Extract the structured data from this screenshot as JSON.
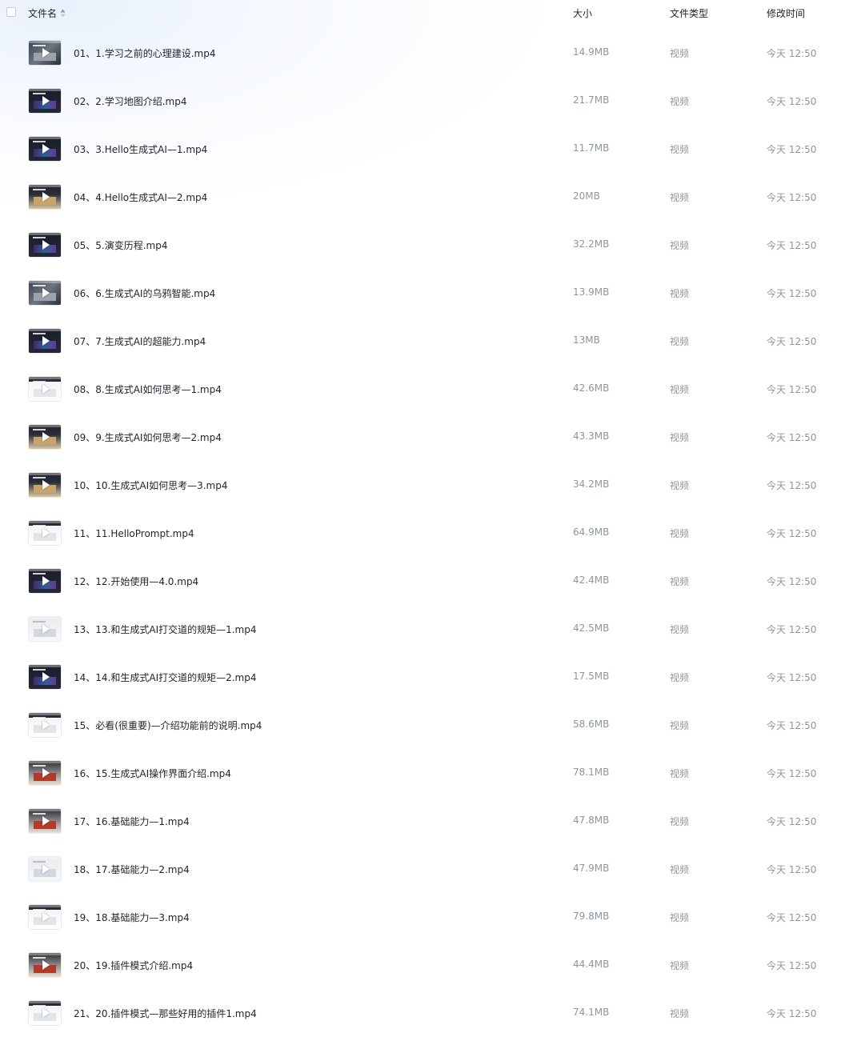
{
  "header": {
    "name": "文件名",
    "size": "大小",
    "type": "文件类型",
    "time": "修改时间"
  },
  "files": [
    {
      "name": "01、1.学习之前的心理建设.mp4",
      "size": "14.9MB",
      "type": "视频",
      "time": "今天 12:50",
      "thumb": "th-photo"
    },
    {
      "name": "02、2.学习地图介绍.mp4",
      "size": "21.7MB",
      "type": "视频",
      "time": "今天 12:50",
      "thumb": "th-dark"
    },
    {
      "name": "03、3.Hello生成式AI—1.mp4",
      "size": "11.7MB",
      "type": "视频",
      "time": "今天 12:50",
      "thumb": "th-dark"
    },
    {
      "name": "04、4.Hello生成式AI—2.mp4",
      "size": "20MB",
      "type": "视频",
      "time": "今天 12:50",
      "thumb": "th-mixed"
    },
    {
      "name": "05、5.演变历程.mp4",
      "size": "32.2MB",
      "type": "视频",
      "time": "今天 12:50",
      "thumb": "th-dark"
    },
    {
      "name": "06、6.生成式AI的乌鸦智能.mp4",
      "size": "13.9MB",
      "type": "视频",
      "time": "今天 12:50",
      "thumb": "th-photo"
    },
    {
      "name": "07、7.生成式AI的超能力.mp4",
      "size": "13MB",
      "type": "视频",
      "time": "今天 12:50",
      "thumb": "th-dark"
    },
    {
      "name": "08、8.生成式AI如何思考—1.mp4",
      "size": "42.6MB",
      "type": "视频",
      "time": "今天 12:50",
      "thumb": "th-white"
    },
    {
      "name": "09、9.生成式AI如何思考—2.mp4",
      "size": "43.3MB",
      "type": "视频",
      "time": "今天 12:50",
      "thumb": "th-mixed"
    },
    {
      "name": "10、10.生成式AI如何思考—3.mp4",
      "size": "34.2MB",
      "type": "视频",
      "time": "今天 12:50",
      "thumb": "th-mixed"
    },
    {
      "name": "11、11.HelloPrompt.mp4",
      "size": "64.9MB",
      "type": "视频",
      "time": "今天 12:50",
      "thumb": "th-white"
    },
    {
      "name": "12、12.开始使用—4.0.mp4",
      "size": "42.4MB",
      "type": "视频",
      "time": "今天 12:50",
      "thumb": "th-dark"
    },
    {
      "name": "13、13.和生成式AI打交道的规矩—1.mp4",
      "size": "42.5MB",
      "type": "视频",
      "time": "今天 12:50",
      "thumb": "th-light"
    },
    {
      "name": "14、14.和生成式AI打交道的规矩—2.mp4",
      "size": "17.5MB",
      "type": "视频",
      "time": "今天 12:50",
      "thumb": "th-dark"
    },
    {
      "name": "15、必看(很重要)—介绍功能前的说明.mp4",
      "size": "58.6MB",
      "type": "视频",
      "time": "今天 12:50",
      "thumb": "th-white"
    },
    {
      "name": "16、15.生成式AI操作界面介绍.mp4",
      "size": "78.1MB",
      "type": "视频",
      "time": "今天 12:50",
      "thumb": "th-warm"
    },
    {
      "name": "17、16.基础能力—1.mp4",
      "size": "47.8MB",
      "type": "视频",
      "time": "今天 12:50",
      "thumb": "th-warm"
    },
    {
      "name": "18、17.基础能力—2.mp4",
      "size": "47.9MB",
      "type": "视频",
      "time": "今天 12:50",
      "thumb": "th-light"
    },
    {
      "name": "19、18.基础能力—3.mp4",
      "size": "79.8MB",
      "type": "视频",
      "time": "今天 12:50",
      "thumb": "th-white"
    },
    {
      "name": "20、19.插件模式介绍.mp4",
      "size": "44.4MB",
      "type": "视频",
      "time": "今天 12:50",
      "thumb": "th-warm"
    },
    {
      "name": "21、20.插件模式—那些好用的插件1.mp4",
      "size": "74.1MB",
      "type": "视频",
      "time": "今天 12:50",
      "thumb": "th-white"
    }
  ],
  "icons": {
    "select_all": "checkbox-icon",
    "sort": "sort-icon",
    "thumb": "video-thumbnail-icon",
    "play": "play-icon"
  }
}
